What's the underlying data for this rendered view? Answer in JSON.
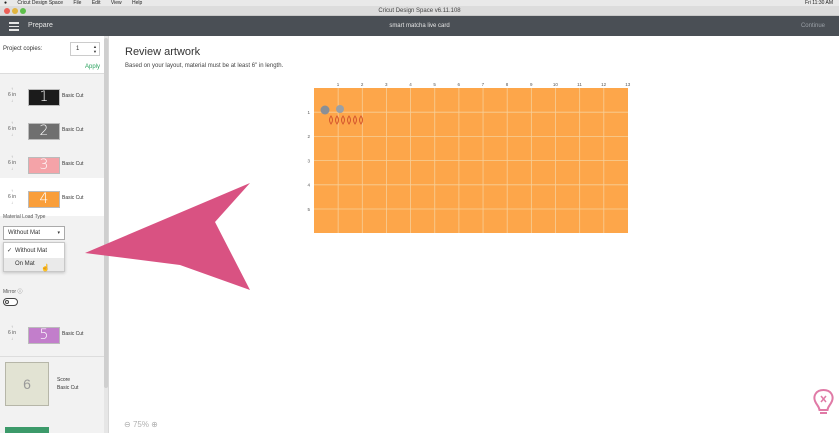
{
  "menubar": {
    "app": "Cricut Design Space",
    "items": [
      "File",
      "Edit",
      "View",
      "Help"
    ],
    "clock": "Fri 11:30 AM"
  },
  "window": {
    "title": "Cricut Design Space  v6.11.108"
  },
  "header": {
    "section": "Prepare",
    "project_name": "smart matcha live card",
    "continue_label": "Continue"
  },
  "left_panel": {
    "project_copies_label": "Project copies:",
    "project_copies_value": "1",
    "apply_label": "Apply",
    "mats": [
      {
        "size": "6 in",
        "number": "1",
        "label": "Basic Cut",
        "color": "#1b1b1b"
      },
      {
        "size": "6 in",
        "number": "2",
        "label": "Basic Cut",
        "color": "#6f6f6f"
      },
      {
        "size": "6 in",
        "number": "3",
        "label": "Basic Cut",
        "color": "#f4a3a8"
      },
      {
        "size": "6 in",
        "number": "4",
        "label": "Basic Cut",
        "color": "#f99e3a"
      },
      {
        "size": "6 in",
        "number": "5",
        "label": "Basic Cut",
        "color": "#c27ecb"
      }
    ],
    "material_load_type_label": "Material Load Type",
    "dropdown_value": "Without Mat",
    "dropdown_options": [
      "Without Mat",
      "On Mat"
    ],
    "mirror_label": "Mirror",
    "score_mat": {
      "number": "6",
      "line1": "Score",
      "line2": "Basic Cut"
    }
  },
  "main": {
    "heading": "Review artwork",
    "subheading": "Based on your layout, material must be at least 6\" in length.",
    "col_ticks": [
      "1",
      "2",
      "3",
      "4",
      "5",
      "6",
      "7",
      "8",
      "9",
      "10",
      "11",
      "12",
      "13"
    ],
    "row_ticks": [
      "1",
      "2",
      "3",
      "4",
      "5"
    ],
    "zoom": "75%"
  },
  "colors": {
    "mat_orange": "#fda64a",
    "grid_line": "#f7cf98",
    "arrow_pink": "#d95282",
    "header_dark": "#4a4f55"
  }
}
